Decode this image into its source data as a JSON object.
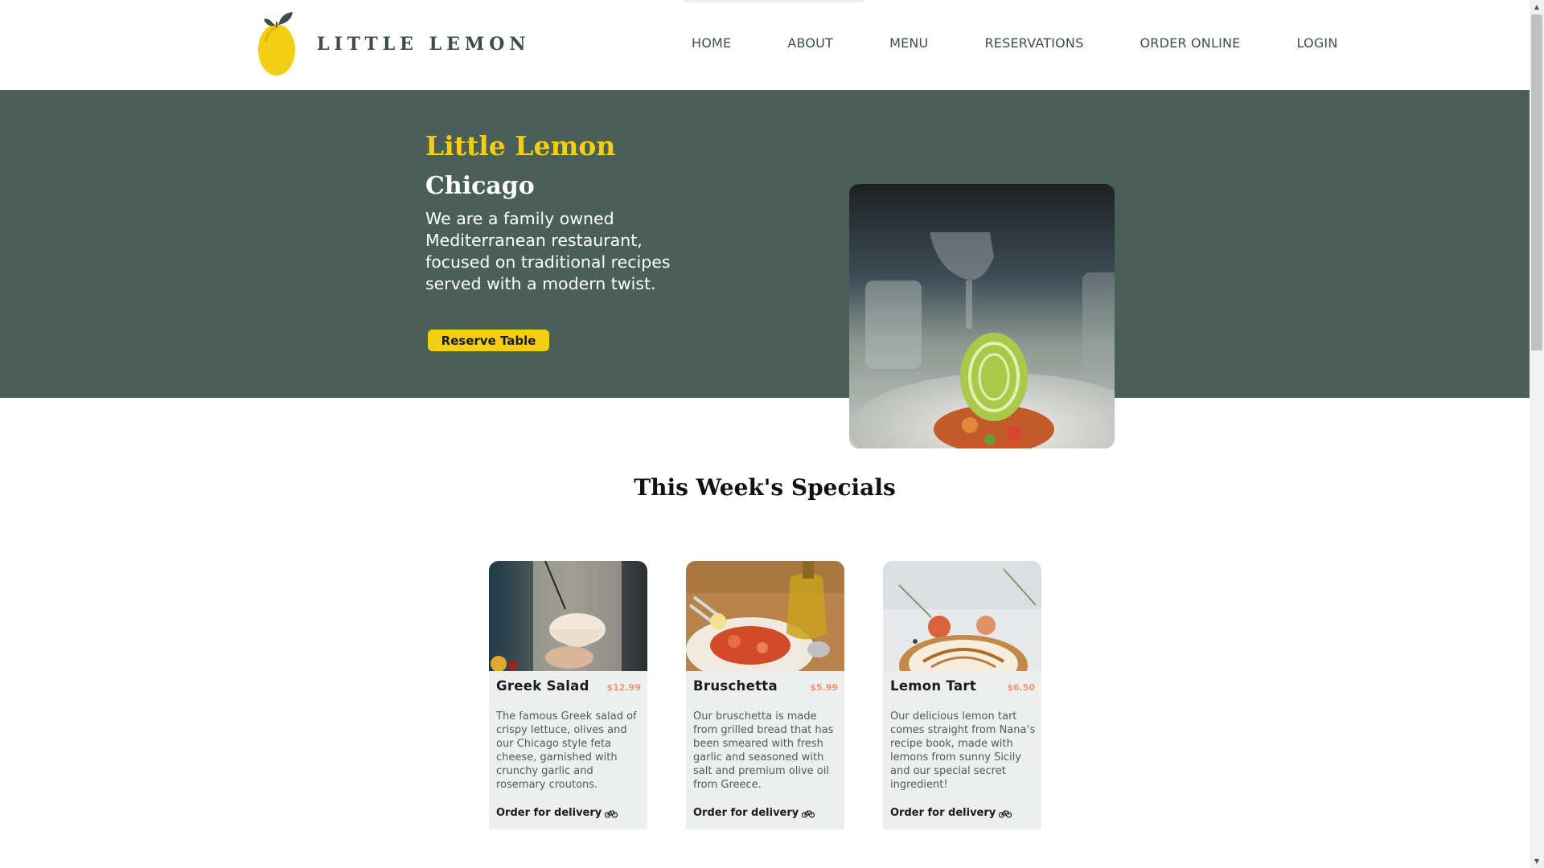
{
  "header": {
    "logo_text": "LITTLE LEMON",
    "nav": [
      "HOME",
      "ABOUT",
      "MENU",
      "RESERVATIONS",
      "ORDER ONLINE",
      "LOGIN"
    ]
  },
  "hero": {
    "title": "Little Lemon",
    "subtitle": "Chicago",
    "description": "We are a family owned Mediterranean restaurant, focused on traditional recipes served with a modern twist.",
    "button_label": "Reserve Table",
    "image_icon": "plated-dish-photo"
  },
  "specials": {
    "title": "This Week's Specials",
    "items": [
      {
        "name": "Greek Salad",
        "price": "$12.99",
        "description": "The famous Greek salad of crispy lettuce, olives and our Chicago style feta cheese, garnished with crunchy garlic and rosemary croutons.",
        "order_label": "Order for delivery",
        "image_icon": "salad-bowl-photo"
      },
      {
        "name": "Bruschetta",
        "price": "$5.99",
        "description": "Our bruschetta is made from grilled bread that has been smeared with fresh garlic and seasoned with salt and premium olive oil from Greece.",
        "order_label": "Order for delivery",
        "image_icon": "bruschetta-photo"
      },
      {
        "name": "Lemon Tart",
        "price": "$6.50",
        "description": "Our delicious lemon tart comes straight from Nana’s recipe book, made with lemons from sunny Sicily and our special secret ingredient!",
        "order_label": "Order for delivery",
        "image_icon": "lemon-tart-photo"
      }
    ]
  },
  "colors": {
    "primary_green": "#4a5f57",
    "primary_yellow": "#f4ce14",
    "card_background": "#edefee",
    "price_accent": "#ee9972"
  }
}
